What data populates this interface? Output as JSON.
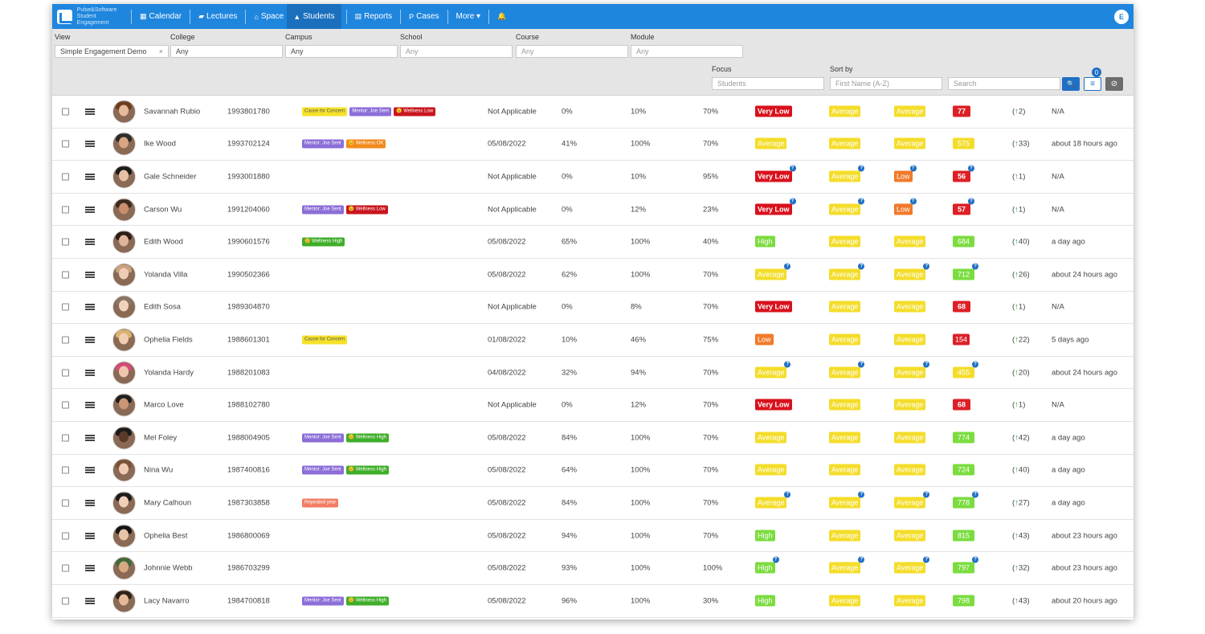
{
  "nav": {
    "logo_text": [
      "Pulse&Software",
      "Student Engagement"
    ],
    "items": [
      {
        "label": "Calendar",
        "icon": "calendar-icon",
        "glyph": "▦"
      },
      {
        "label": "Lectures",
        "icon": "book-icon",
        "glyph": "▰"
      },
      {
        "label": "Space",
        "icon": "building-icon",
        "glyph": "⌂"
      },
      {
        "label": "Students",
        "icon": "graduation-cap-icon",
        "glyph": "▲"
      },
      {
        "label": "Reports",
        "icon": "file-icon",
        "glyph": "▤"
      },
      {
        "label": "Cases",
        "icon": "p-icon",
        "glyph": "P"
      },
      {
        "label": "More ▾",
        "icon": "",
        "glyph": ""
      }
    ],
    "bell_glyph": "🔔",
    "user_initial": "E"
  },
  "filters": {
    "view_label": "View",
    "view_value": "Simple Engagement Demo",
    "view_clear": "×",
    "college_label": "College",
    "college_value": "Any",
    "campus_label": "Campus",
    "campus_value": "Any",
    "school_label": "School",
    "school_placeholder": "Any",
    "course_label": "Course",
    "course_placeholder": "Any",
    "module_label": "Module",
    "module_placeholder": "Any",
    "focus_label": "Focus",
    "focus_value": "Students",
    "sort_label": "Sort by",
    "sort_value": "First Name (A-Z)",
    "search_placeholder": "Search",
    "filter_count": "0",
    "search_glyph": "🔍",
    "filter_glyph": "≡",
    "reset_glyph": "⊘"
  },
  "students": [
    {
      "name": "Savannah Rubio",
      "id": "1993801780",
      "tags": [
        [
          "Cause for Concern",
          "yellow"
        ],
        [
          "Mentor: Joe Sent",
          "purple"
        ],
        [
          "😟 Wellness Low",
          "red"
        ]
      ],
      "date": "Not Applicable",
      "p1": "0%",
      "p2": "10%",
      "p3": "70%",
      "eng": [
        "Very Low",
        "verylow",
        false
      ],
      "c2": [
        "Average",
        "avg",
        false
      ],
      "c3": [
        "Average",
        "avg",
        false
      ],
      "score": [
        "77",
        "red",
        false
      ],
      "trend": "2",
      "trend_info": false,
      "last": "N/A",
      "skin": "#e6b999",
      "hair": "#6b3d1f"
    },
    {
      "name": "Ike Wood",
      "id": "1993702124",
      "tags": [
        [
          "Mentor: Joe Sent",
          "purple"
        ],
        [
          "😐 Wellness OK",
          "orange"
        ]
      ],
      "date": "05/08/2022",
      "p1": "41%",
      "p2": "100%",
      "p3": "70%",
      "eng": [
        "Average",
        "avg",
        false
      ],
      "c2": [
        "Average",
        "avg",
        false
      ],
      "c3": [
        "Average",
        "avg",
        false
      ],
      "score": [
        "575",
        "yellow",
        false
      ],
      "trend": "33",
      "trend_info": false,
      "last": "about 18 hours ago",
      "skin": "#d9a582",
      "hair": "#2b2b2b"
    },
    {
      "name": "Gale Schneider",
      "id": "1993001880",
      "tags": [],
      "date": "Not Applicable",
      "p1": "0%",
      "p2": "10%",
      "p3": "95%",
      "eng": [
        "Very Low",
        "verylow",
        true
      ],
      "c2": [
        "Average",
        "avg",
        true
      ],
      "c3": [
        "Low",
        "low",
        true
      ],
      "score": [
        "56",
        "red",
        true
      ],
      "trend": "1",
      "trend_info": true,
      "last": "N/A",
      "skin": "#e8c0a6",
      "hair": "#1a1a1a"
    },
    {
      "name": "Carson Wu",
      "id": "1991204060",
      "tags": [
        [
          "Mentor: Joe Sent",
          "purple"
        ],
        [
          "😟 Wellness Low",
          "red"
        ]
      ],
      "date": "Not Applicable",
      "p1": "0%",
      "p2": "12%",
      "p3": "23%",
      "eng": [
        "Very Low",
        "verylow",
        true
      ],
      "c2": [
        "Average",
        "avg",
        true
      ],
      "c3": [
        "Low",
        "low",
        true
      ],
      "score": [
        "57",
        "red",
        true
      ],
      "trend": "1",
      "trend_info": true,
      "last": "N/A",
      "skin": "#c98e6a",
      "hair": "#3a2a1f"
    },
    {
      "name": "Edith Wood",
      "id": "1990601576",
      "tags": [
        [
          "😊 Wellness High",
          "green"
        ]
      ],
      "date": "05/08/2022",
      "p1": "65%",
      "p2": "100%",
      "p3": "40%",
      "eng": [
        "High",
        "high",
        false
      ],
      "c2": [
        "Average",
        "avg",
        false
      ],
      "c3": [
        "Average",
        "avg",
        false
      ],
      "score": [
        "684",
        "green",
        false
      ],
      "trend": "40",
      "trend_info": false,
      "last": "a day ago",
      "skin": "#e0b49a",
      "hair": "#2a1d15"
    },
    {
      "name": "Yolanda Villa",
      "id": "1990502366",
      "tags": [],
      "date": "05/08/2022",
      "p1": "62%",
      "p2": "100%",
      "p3": "70%",
      "eng": [
        "Average",
        "avg",
        true
      ],
      "c2": [
        "Average",
        "avg",
        true
      ],
      "c3": [
        "Average",
        "avg",
        true
      ],
      "score": [
        "712",
        "green",
        true
      ],
      "trend": "26",
      "trend_info": true,
      "last": "about 24 hours ago",
      "skin": "#f0ccb4",
      "hair": "#c9a27e"
    },
    {
      "name": "Edith Sosa",
      "id": "1989304870",
      "tags": [],
      "date": "Not Applicable",
      "p1": "0%",
      "p2": "8%",
      "p3": "70%",
      "eng": [
        "Very Low",
        "verylow",
        false
      ],
      "c2": [
        "Average",
        "avg",
        false
      ],
      "c3": [
        "Average",
        "avg",
        false
      ],
      "score": [
        "68",
        "red",
        false
      ],
      "trend": "1",
      "trend_info": false,
      "last": "N/A",
      "skin": "#f1d2bd",
      "hair": "#8a7565"
    },
    {
      "name": "Ophelia Fields",
      "id": "1988601301",
      "tags": [
        [
          "Cause for Concern",
          "yellow"
        ]
      ],
      "date": "01/08/2022",
      "p1": "10%",
      "p2": "46%",
      "p3": "75%",
      "eng": [
        "Low",
        "low",
        false
      ],
      "c2": [
        "Average",
        "avg",
        false
      ],
      "c3": [
        "Average",
        "avg",
        false
      ],
      "score": [
        "154",
        "redcheck",
        false
      ],
      "trend": "22",
      "trend_info": false,
      "last": "5 days ago",
      "skin": "#f1cdb2",
      "hair": "#d8b270"
    },
    {
      "name": "Yolanda Hardy",
      "id": "1988201083",
      "tags": [],
      "date": "04/08/2022",
      "p1": "32%",
      "p2": "94%",
      "p3": "70%",
      "eng": [
        "Average",
        "avg",
        true
      ],
      "c2": [
        "Average",
        "avg",
        true
      ],
      "c3": [
        "Average",
        "avg",
        true
      ],
      "score": [
        "455",
        "yellow",
        true
      ],
      "trend": "20",
      "trend_info": true,
      "last": "about 24 hours ago",
      "skin": "#efc5ad",
      "hair": "#d44a7a"
    },
    {
      "name": "Marco Love",
      "id": "1988102780",
      "tags": [],
      "date": "Not Applicable",
      "p1": "0%",
      "p2": "12%",
      "p3": "70%",
      "eng": [
        "Very Low",
        "verylow",
        false
      ],
      "c2": [
        "Average",
        "avg",
        false
      ],
      "c3": [
        "Average",
        "avg",
        false
      ],
      "score": [
        "68",
        "red",
        false
      ],
      "trend": "1",
      "trend_info": false,
      "last": "N/A",
      "skin": "#c99778",
      "hair": "#1f1f1f"
    },
    {
      "name": "Mel Foley",
      "id": "1988004905",
      "tags": [
        [
          "Mentor: Joe Sent",
          "purple"
        ],
        [
          "😊 Wellness High",
          "green"
        ]
      ],
      "date": "05/08/2022",
      "p1": "84%",
      "p2": "100%",
      "p3": "70%",
      "eng": [
        "Average",
        "avg",
        false
      ],
      "c2": [
        "Average",
        "avg",
        false
      ],
      "c3": [
        "Average",
        "avg",
        false
      ],
      "score": [
        "774",
        "green",
        false
      ],
      "trend": "42",
      "trend_info": false,
      "last": "a day ago",
      "skin": "#5a3a28",
      "hair": "#1a1a1a"
    },
    {
      "name": "Nina Wu",
      "id": "1987400816",
      "tags": [
        [
          "Mentor: Joe Sent",
          "purple"
        ],
        [
          "😊 Wellness High",
          "green"
        ]
      ],
      "date": "05/08/2022",
      "p1": "64%",
      "p2": "100%",
      "p3": "70%",
      "eng": [
        "Average",
        "avg",
        false
      ],
      "c2": [
        "Average",
        "avg",
        false
      ],
      "c3": [
        "Average",
        "avg",
        false
      ],
      "score": [
        "724",
        "green",
        false
      ],
      "trend": "40",
      "trend_info": false,
      "last": "a day ago",
      "skin": "#f0cbb3",
      "hair": "#7a5238"
    },
    {
      "name": "Mary Calhoun",
      "id": "1987303858",
      "tags": [
        [
          "Repeated year",
          "salmon"
        ]
      ],
      "date": "05/08/2022",
      "p1": "84%",
      "p2": "100%",
      "p3": "70%",
      "eng": [
        "Average",
        "avg",
        true
      ],
      "c2": [
        "Average",
        "avg",
        true
      ],
      "c3": [
        "Average",
        "avg",
        true
      ],
      "score": [
        "778",
        "green",
        true
      ],
      "trend": "27",
      "trend_info": true,
      "last": "a day ago",
      "skin": "#f0cfb8",
      "hair": "#1c1c1c"
    },
    {
      "name": "Ophelia Best",
      "id": "1986800069",
      "tags": [],
      "date": "05/08/2022",
      "p1": "94%",
      "p2": "100%",
      "p3": "70%",
      "eng": [
        "High",
        "high",
        false
      ],
      "c2": [
        "Average",
        "avg",
        false
      ],
      "c3": [
        "Average",
        "avg",
        false
      ],
      "score": [
        "815",
        "green",
        false
      ],
      "trend": "43",
      "trend_info": false,
      "last": "about 23 hours ago",
      "skin": "#e9c3a6",
      "hair": "#151515"
    },
    {
      "name": "Johnnie Webb",
      "id": "1986703299",
      "tags": [],
      "date": "05/08/2022",
      "p1": "93%",
      "p2": "100%",
      "p3": "100%",
      "eng": [
        "High",
        "high",
        true
      ],
      "c2": [
        "Average",
        "avg",
        true
      ],
      "c3": [
        "Average",
        "avg",
        true
      ],
      "score": [
        "797",
        "green",
        true
      ],
      "trend": "32",
      "trend_info": true,
      "last": "about 23 hours ago",
      "skin": "#d9a983",
      "hair": "#3d6b3a"
    },
    {
      "name": "Lacy Navarro",
      "id": "1984700818",
      "tags": [
        [
          "Mentor: Joe Sent",
          "purple"
        ],
        [
          "😊 Wellness High",
          "green"
        ]
      ],
      "date": "05/08/2022",
      "p1": "96%",
      "p2": "100%",
      "p3": "30%",
      "eng": [
        "High",
        "high",
        false
      ],
      "c2": [
        "Average",
        "avg",
        false
      ],
      "c3": [
        "Average",
        "avg",
        false
      ],
      "score": [
        "798",
        "green",
        false
      ],
      "trend": "43",
      "trend_info": false,
      "last": "about 20 hours ago",
      "skin": "#e5b898",
      "hair": "#2c2218"
    }
  ]
}
